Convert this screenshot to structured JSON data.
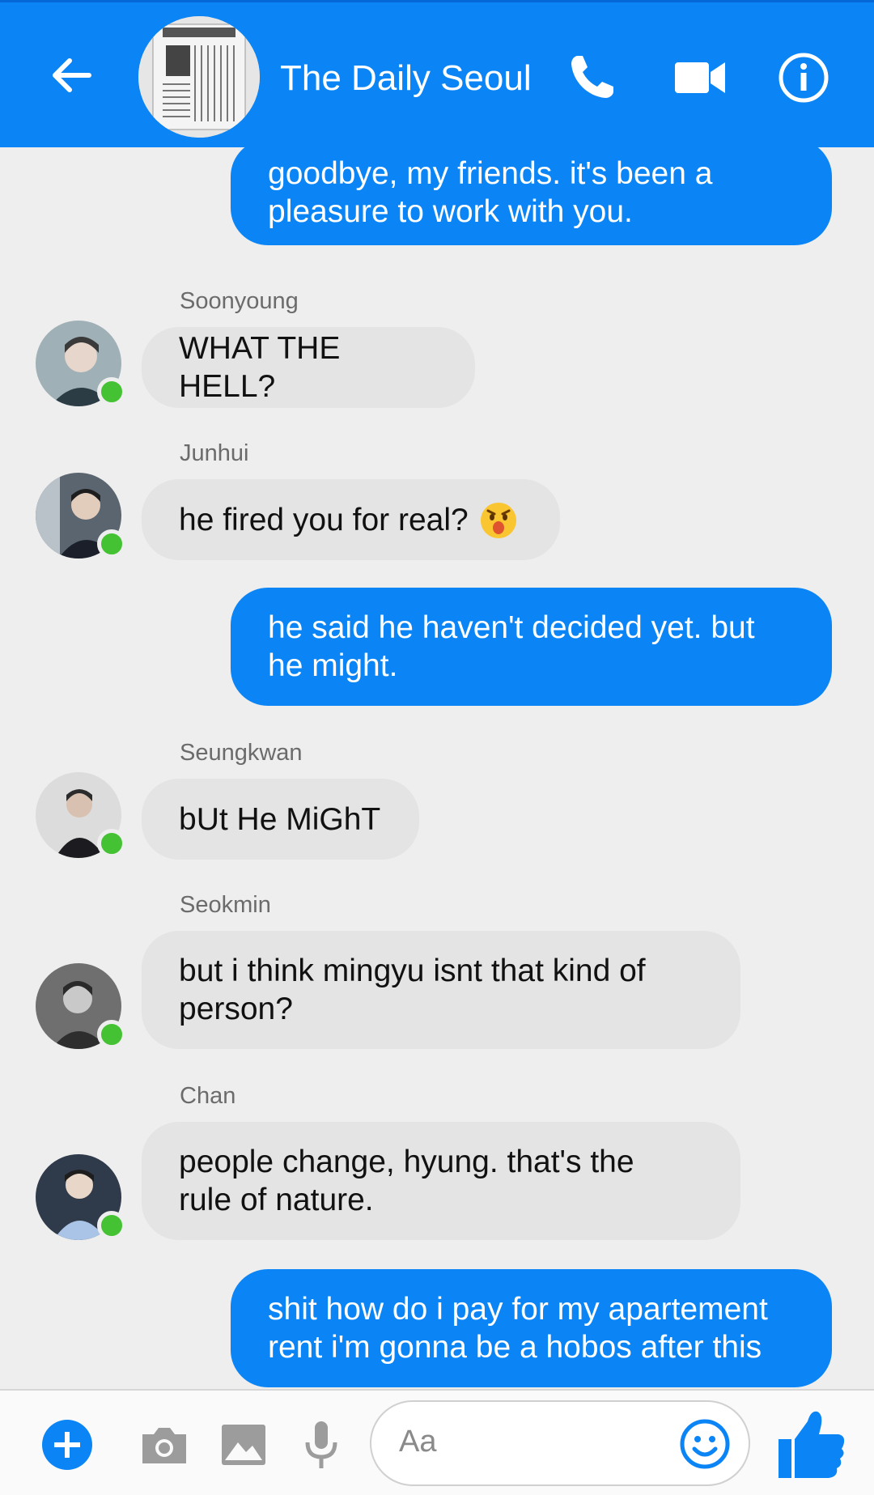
{
  "header": {
    "title": "The Daily Seoul",
    "back_icon": "arrow-back-icon",
    "call_icon": "phone-icon",
    "video_icon": "video-camera-icon",
    "info_icon": "info-icon",
    "bg_color": "#0b85f5"
  },
  "messages": [
    {
      "direction": "out",
      "lines": [
        "goodbye, my friends. it's been a",
        "pleasure to work with you."
      ]
    },
    {
      "direction": "in",
      "sender": "Soonyoung",
      "lines": [
        "WHAT THE HELL?"
      ]
    },
    {
      "direction": "in",
      "sender": "Junhui",
      "lines": [
        "he fired you for real?"
      ],
      "emoji": "astonished-face-emoji"
    },
    {
      "direction": "out",
      "lines": [
        "he said he haven't decided yet. but",
        "he might."
      ]
    },
    {
      "direction": "in",
      "sender": "Seungkwan",
      "lines": [
        "bUt He MiGhT"
      ]
    },
    {
      "direction": "in",
      "sender": "Seokmin",
      "lines": [
        "but i think mingyu isnt that kind of",
        "person?"
      ]
    },
    {
      "direction": "in",
      "sender": "Chan",
      "lines": [
        "people change, hyung. that's the",
        "rule of nature."
      ]
    },
    {
      "direction": "out",
      "lines": [
        "shit how do i pay for my apartement",
        "rent i'm gonna be a hobos after this"
      ]
    }
  ],
  "composer": {
    "placeholder": "Aa",
    "icons": [
      "plus-icon",
      "camera-icon",
      "image-icon",
      "microphone-icon",
      "emoji-icon",
      "thumbs-up-icon"
    ]
  },
  "colors": {
    "accent": "#0b85f5",
    "online": "#44c233",
    "incoming_bubble": "#e4e4e4",
    "background": "#eeeeee"
  }
}
